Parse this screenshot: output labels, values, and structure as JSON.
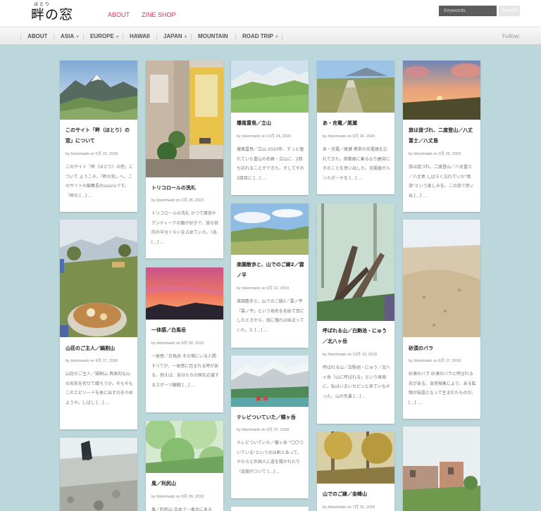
{
  "header": {
    "logo_ruby": "ほとり",
    "logo": "畔の窓",
    "links": [
      "ABOUT",
      "ZINE SHOP"
    ],
    "search_placeholder": "Keywords",
    "search_button": "Search"
  },
  "nav": {
    "items": [
      {
        "label": "ABOUT",
        "dropdown": false
      },
      {
        "label": "ASIA",
        "dropdown": true
      },
      {
        "label": "EUROPE",
        "dropdown": true
      },
      {
        "label": "HAWAII",
        "dropdown": false
      },
      {
        "label": "JAPAN",
        "dropdown": true
      },
      {
        "label": "MOUNTAIN",
        "dropdown": false
      },
      {
        "label": "ROAD TRIP",
        "dropdown": true
      }
    ],
    "follow": "Follow:"
  },
  "colors": {
    "accent": "#d6335a",
    "background": "#bcd7db"
  },
  "posts": [
    {
      "title": "このサイト「畔（ほとり）の窓」について",
      "by": "by",
      "author": "fotorimado",
      "on": "on",
      "date": "5月 10, 2018",
      "excerpt": "このサイト「畔（ほとり）の窓」について ようこそ。『畔の窓』へ。このサイトの編集長のsaorinです。「畔の [...] ..."
    },
    {
      "title": "山荘のご主人／鍋割山",
      "by": "by",
      "author": "fotorimado",
      "on": "on",
      "date": "9月 17, 2018",
      "excerpt": "山荘のご主人／鍋割山 具体的な山の名前を伏せて綴ろうか。そもそもこのエピソードを表に出すのをやめようか。しばし [...] ..."
    },
    {
      "title": "",
      "by": "",
      "author": "",
      "on": "",
      "date": "",
      "excerpt": ""
    },
    {
      "title": "トリコロールの洗礼",
      "by": "by",
      "author": "fotorimado",
      "on": "on",
      "date": "2月 28, 2023",
      "excerpt": "トリコロールの洗礼 かつて雑貨やアンティークの類が好きで、旅の目的の半分くらいを占めていた。（あ [...] ..."
    },
    {
      "title": "一体感／白馬岳",
      "by": "by",
      "author": "fotorimado",
      "on": "on",
      "date": "9月 09, 2018",
      "excerpt": "一体感／白馬岳 その場にいる人間すべてが、一体感に包まれる時がある。例えば、自分たちの国を応援するスポーツ観戦 [...] ..."
    },
    {
      "title": "風／利尻山",
      "by": "by",
      "author": "fotorimado",
      "on": "on",
      "date": "8月 09, 2018",
      "excerpt": "風／利尻山 日本で一番北にある [...]"
    },
    {
      "title": "爆風雷鳥／立山",
      "by": "by",
      "author": "fotorimado",
      "on": "on",
      "date": "12月 24, 2020",
      "excerpt": "爆風雷鳥／立山 2020年、ずっと憧れていた富山の名峰・立山に、2回も訪れることができた。そしてその2度目に [...] ..."
    },
    {
      "title": "楽園散歩と、山でのご縁2／雲ノ平",
      "by": "by",
      "author": "fotorimado",
      "on": "on",
      "date": "5月 22, 2019",
      "excerpt": "楽園散歩と、山でのご縁2／雲ノ平「雲ノ平」という地名を初めて耳にしたときから、既に憧れは始まっていた。3, [...] ..."
    },
    {
      "title": "テレビついていた／蝶ヶ岳",
      "by": "by",
      "author": "fotorimado",
      "on": "on",
      "date": "9月 07, 2018",
      "excerpt": "テレビついていた／蝶ヶ岳 \"〇〇ついている\"というのは割とあって、やたらと外国人に道を聞かれたり（道案内ついて [...] ..."
    },
    {
      "title": "あ・充電／尾瀬",
      "by": "by",
      "author": "fotorimado",
      "on": "on",
      "date": "9月 24, 2020",
      "excerpt": "あ・充電／尾瀬 携帯の充電器を忘れてきた。首都高に乗るなり唐突にそのことを思い出した。充電器が入ったポーチを [...] ..."
    },
    {
      "title": "呼ばれる山／白駒池・にゅう／北八ヶ岳",
      "by": "by",
      "author": "fotorimado",
      "on": "on",
      "date": "10月 13, 2018",
      "excerpt": "呼ばれる山／白駒池・にゅう／北八ヶ岳「山に呼ばれる」という表現に、私はいまいちピンと来ていなかった。山の先輩 [...] ..."
    },
    {
      "title": "山でのご縁／金峰山",
      "by": "by",
      "author": "fotorimado",
      "on": "on",
      "date": "7月 25, 2018",
      "excerpt": ""
    },
    {
      "title": "旅は道づれ、二度登山／八丈富士／八丈島",
      "by": "by",
      "author": "fotorimado",
      "on": "on",
      "date": "3月 29, 2020",
      "excerpt": "旅は道づれ、二度登山／八丈富士／八丈島 しばらく忘れていた\"島旅\"という楽しみを。この旅で思い出 [...] ..."
    },
    {
      "title": "砂漠のバラ",
      "by": "by",
      "author": "fotorimado",
      "on": "on",
      "date": "9月 17, 2018",
      "excerpt": "砂漠のバラ 砂漠のバラと呼ばれる花がある。自然現象により、ある鉱物が結晶となって生まれたものだ。 [...] ..."
    },
    {
      "title": "",
      "by": "",
      "author": "",
      "on": "",
      "date": "",
      "excerpt": ""
    }
  ]
}
